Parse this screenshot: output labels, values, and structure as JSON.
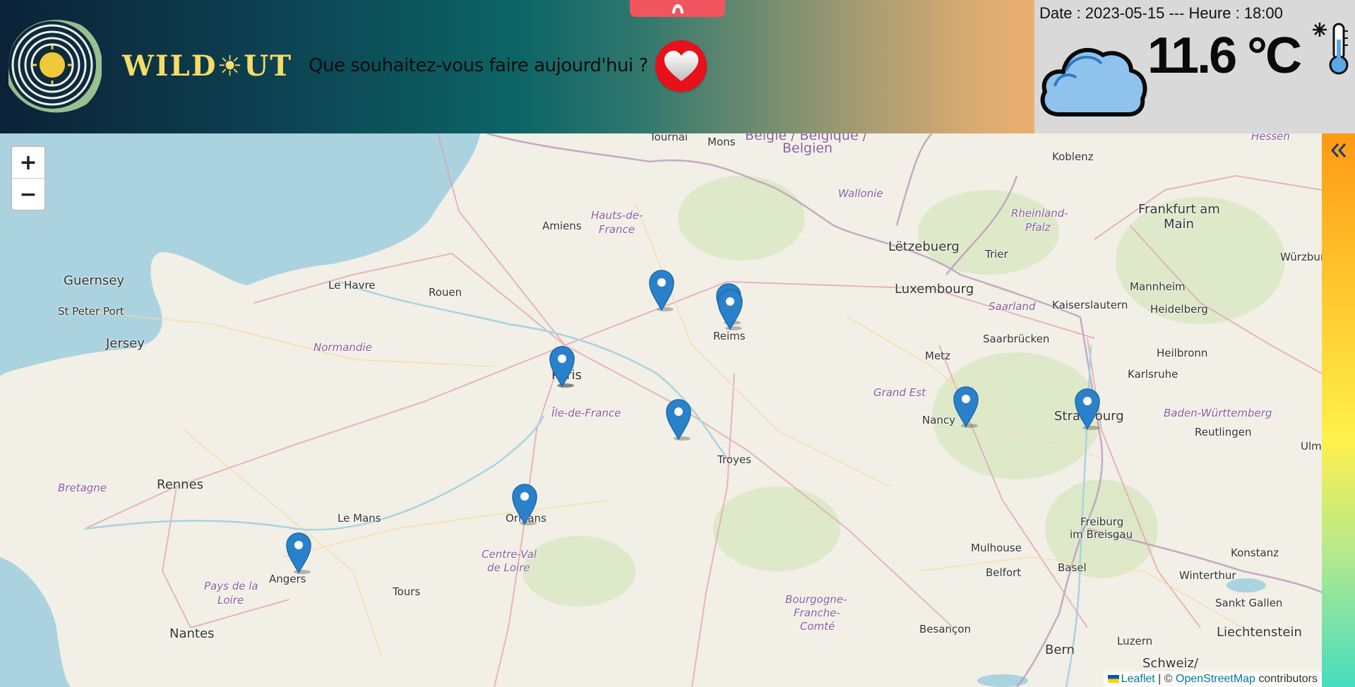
{
  "header": {
    "brand_name": "WILD☀UT",
    "prompt": "Que souhaitez-vous faire aujourd'hui ?",
    "favorites_icon": "heart-icon",
    "top_tab_icon": "chevron-up-icon"
  },
  "weather": {
    "date_line": "Date : 2023-05-15 --- Heure : 18:00",
    "temperature": "11.6 °C",
    "condition_icon": "cloud-icon",
    "thermometer_icon": "thermometer-cold-icon"
  },
  "map": {
    "zoom_in": "+",
    "zoom_out": "−",
    "attribution": {
      "leaflet": "Leaflet",
      "separator": " | © ",
      "osm": "OpenStreetMap",
      "suffix": " contributors"
    },
    "place_labels": {
      "tournai": "Tournai",
      "mons": "Mons",
      "belgique": "België / Belgique /",
      "belgien": "Belgien",
      "hessen": "Hessen",
      "koblenz": "Koblenz",
      "wallonie": "Wallonie",
      "hauts": "Hauts-de-",
      "france": "France",
      "amiens": "Amiens",
      "frankfurt": "Frankfurt am",
      "main": "Main",
      "rheinland": "Rheinland-",
      "pfalz": "Pfalz",
      "guernsey": "Guernsey",
      "stpeter": "St Peter Port",
      "jersey": "Jersey",
      "lehavre": "Le Havre",
      "rouen": "Rouen",
      "letzebuerg": "Lëtzebuerg",
      "trier": "Trier",
      "wurzburg": "Würzburg",
      "luxembourg": "Luxembourg",
      "mannheim": "Mannheim",
      "saarland": "Saarland",
      "kaiserslautern": "Kaiserslautern",
      "heidelberg": "Heidelberg",
      "reims": "Reims",
      "normandie": "Normandie",
      "saarbrucken": "Saarbrücken",
      "metz": "Metz",
      "heilbronn": "Heilbronn",
      "paris": "Paris",
      "karlsruhe": "Karlsruhe",
      "grandest": "Grand Est",
      "iledefrance": "Île-de-France",
      "nancy": "Nancy",
      "strasbourg": "Strasbourg",
      "badenw": "Baden-Württemberg",
      "reutlingen": "Reutlingen",
      "ulm": "Ulm",
      "troyes": "Troyes",
      "bretagne": "Bretagne",
      "rennes": "Rennes",
      "lemans": "Le Mans",
      "orleans": "Orléans",
      "freiburg": "Freiburg",
      "imbreisgau": "im Breisgau",
      "mulhouse": "Mulhouse",
      "konstanz": "Konstanz",
      "centre": "Centre-Val",
      "deloire": "de Loire",
      "belfort": "Belfort",
      "basel": "Basel",
      "winterthur": "Winterthur",
      "angers": "Angers",
      "tours": "Tours",
      "paysdela": "Pays de la",
      "loire": "Loire",
      "bourgogne": "Bourgogne-",
      "franche": "Franche-",
      "comte": "Comté",
      "sanktgallen": "Sankt Gallen",
      "nantes": "Nantes",
      "besancon": "Besançon",
      "liechtenstein": "Liechtenstein",
      "bern": "Bern",
      "luzern": "Luzern",
      "schweiz": "Schweiz/"
    },
    "marker_count": 10
  },
  "side_panel": {
    "collapse_icon": "double-chevron-left-icon"
  },
  "colors": {
    "water": "#aad3df",
    "land": "#f2efe6",
    "marker": "#2a81cb",
    "heart_button": "#e8101a",
    "brand_gold": "#f4dc67"
  }
}
